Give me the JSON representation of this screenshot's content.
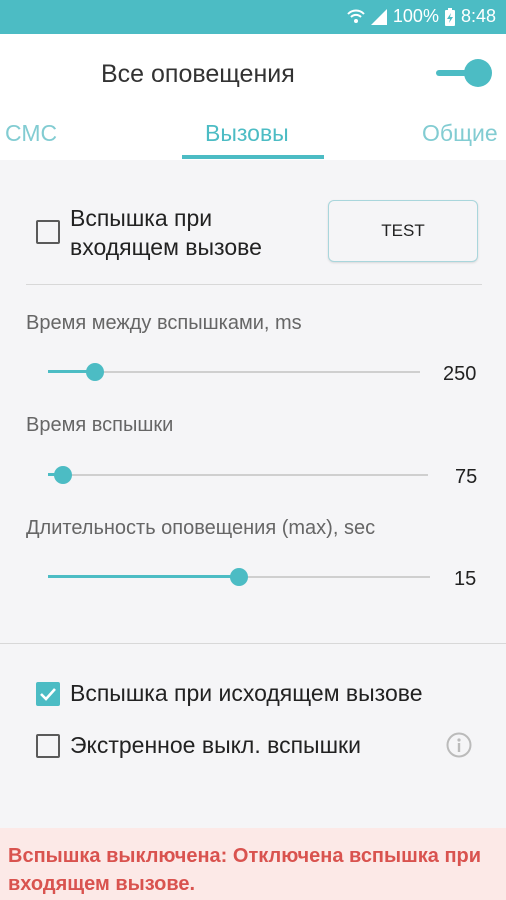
{
  "status_bar": {
    "battery": "100%",
    "time": "8:48",
    "icons": [
      "wifi-icon",
      "signal-icon",
      "battery-charging-icon"
    ]
  },
  "header": {
    "title": "Все оповещения",
    "master_switch": true
  },
  "tabs": [
    {
      "label": "СМС",
      "active": false
    },
    {
      "label": "Вызовы",
      "active": true
    },
    {
      "label": "Общие",
      "active": false
    }
  ],
  "incoming": {
    "checkbox_checked": false,
    "label_line1": "Вспышка при",
    "label_line2": "входящем вызове",
    "test_label": "TEST"
  },
  "sliders": [
    {
      "label": "Время между вспышками, ms",
      "value": "250",
      "fraction": 0.125
    },
    {
      "label": "Время вспышки",
      "value": "75",
      "fraction": 0.04
    },
    {
      "label": "Длительность оповещения (max), sec",
      "value": "15",
      "fraction": 0.5
    }
  ],
  "options": [
    {
      "label": "Вспышка при исходящем вызове",
      "checked": true
    },
    {
      "label": "Экстренное выкл. вспышки",
      "checked": false,
      "icon": "info-icon"
    }
  ],
  "warning": "Вспышка выключена: Отключена вспышка при входящем вызове.",
  "colors": {
    "accent": "#4cbcc4",
    "warning": "#d9534f",
    "warning_bg": "#fce9e7"
  }
}
